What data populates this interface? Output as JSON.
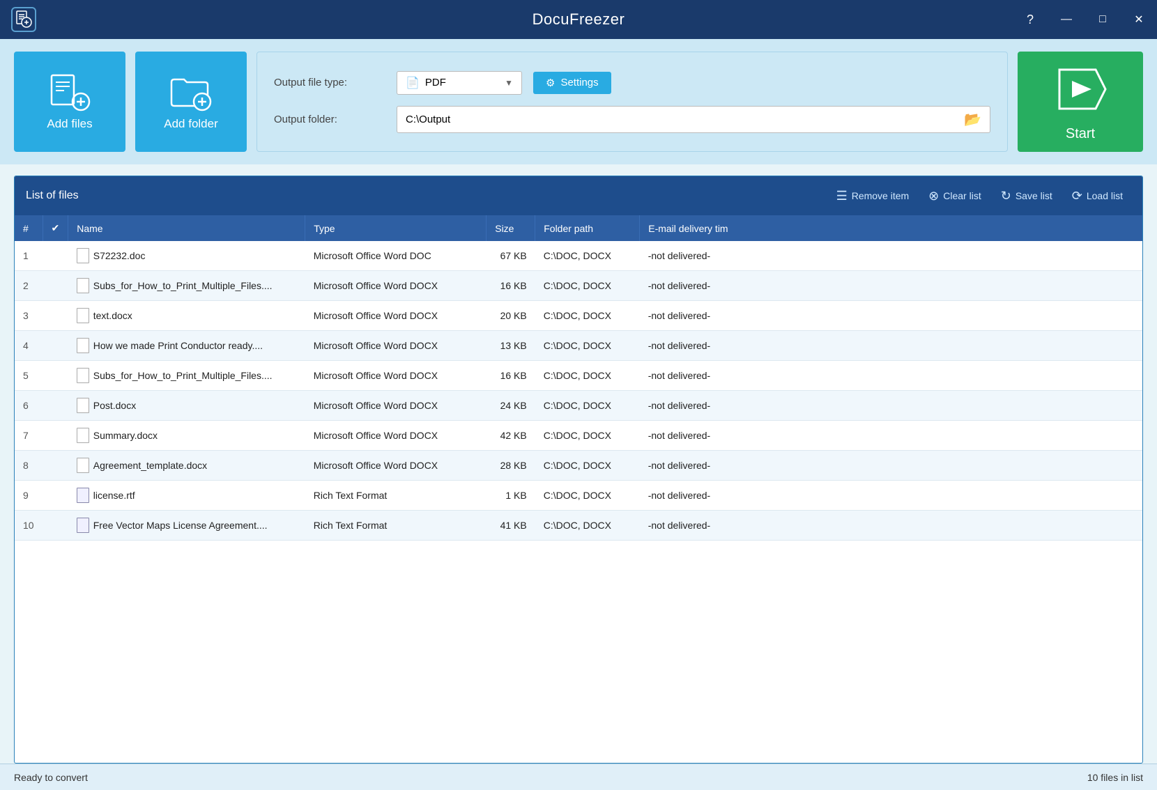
{
  "app": {
    "title": "DocuFreezer",
    "logo": "📄"
  },
  "titlebar": {
    "help_label": "?",
    "minimize_label": "—",
    "maximize_label": "□",
    "close_label": "✕"
  },
  "toolbar": {
    "add_files_label": "Add files",
    "add_folder_label": "Add folder",
    "output_file_type_label": "Output file type:",
    "output_folder_label": "Output folder:",
    "pdf_option": "PDF",
    "settings_label": "Settings",
    "output_folder_value": "C:\\Output",
    "start_label": "Start"
  },
  "file_list": {
    "title": "List of files",
    "remove_item_label": "Remove item",
    "clear_list_label": "Clear list",
    "save_list_label": "Save list",
    "load_list_label": "Load list",
    "columns": [
      "#",
      "✔",
      "Name",
      "Type",
      "Size",
      "Folder path",
      "E-mail delivery tim"
    ],
    "rows": [
      {
        "num": 1,
        "name": "S72232.doc",
        "type": "Microsoft Office Word DOC",
        "size": "67 KB",
        "folder": "C:\\DOC, DOCX",
        "email": "-not delivered-",
        "icon": "doc"
      },
      {
        "num": 2,
        "name": "Subs_for_How_to_Print_Multiple_Files....",
        "type": "Microsoft Office Word DOCX",
        "size": "16 KB",
        "folder": "C:\\DOC, DOCX",
        "email": "-not delivered-",
        "icon": "docx"
      },
      {
        "num": 3,
        "name": "text.docx",
        "type": "Microsoft Office Word DOCX",
        "size": "20 KB",
        "folder": "C:\\DOC, DOCX",
        "email": "-not delivered-",
        "icon": "docx"
      },
      {
        "num": 4,
        "name": "How we made Print Conductor ready....",
        "type": "Microsoft Office Word DOCX",
        "size": "13 KB",
        "folder": "C:\\DOC, DOCX",
        "email": "-not delivered-",
        "icon": "docx"
      },
      {
        "num": 5,
        "name": "Subs_for_How_to_Print_Multiple_Files....",
        "type": "Microsoft Office Word DOCX",
        "size": "16 KB",
        "folder": "C:\\DOC, DOCX",
        "email": "-not delivered-",
        "icon": "docx"
      },
      {
        "num": 6,
        "name": "Post.docx",
        "type": "Microsoft Office Word DOCX",
        "size": "24 KB",
        "folder": "C:\\DOC, DOCX",
        "email": "-not delivered-",
        "icon": "docx"
      },
      {
        "num": 7,
        "name": "Summary.docx",
        "type": "Microsoft Office Word DOCX",
        "size": "42 KB",
        "folder": "C:\\DOC, DOCX",
        "email": "-not delivered-",
        "icon": "docx"
      },
      {
        "num": 8,
        "name": "Agreement_template.docx",
        "type": "Microsoft Office Word DOCX",
        "size": "28 KB",
        "folder": "C:\\DOC, DOCX",
        "email": "-not delivered-",
        "icon": "docx"
      },
      {
        "num": 9,
        "name": "license.rtf",
        "type": "Rich Text Format",
        "size": "1 KB",
        "folder": "C:\\DOC, DOCX",
        "email": "-not delivered-",
        "icon": "rtf"
      },
      {
        "num": 10,
        "name": "Free Vector Maps License Agreement....",
        "type": "Rich Text Format",
        "size": "41 KB",
        "folder": "C:\\DOC, DOCX",
        "email": "-not delivered-",
        "icon": "rtf"
      }
    ]
  },
  "statusbar": {
    "status": "Ready to convert",
    "file_count": "10 files in list"
  }
}
